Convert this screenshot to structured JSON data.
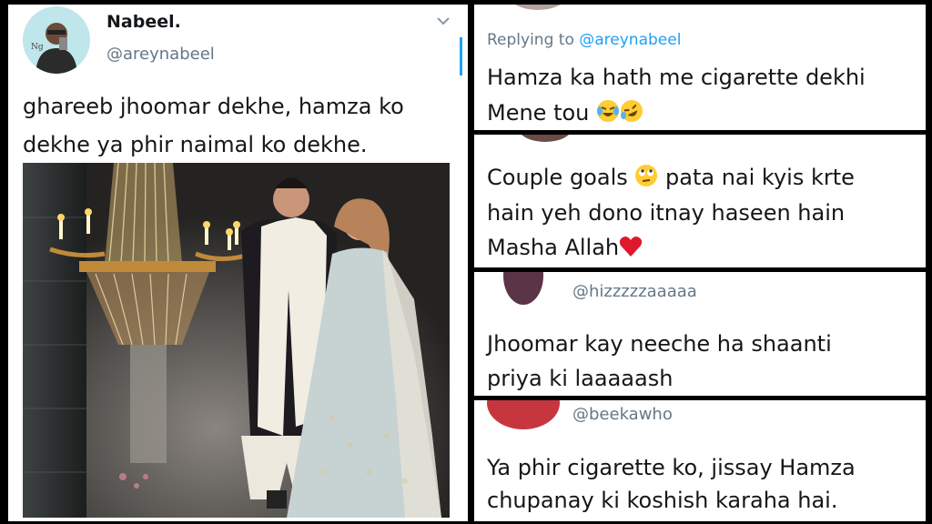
{
  "tweet": {
    "name": "Nabeel.",
    "handle": "@areynabeel",
    "text_line1": "ghareeb jhoomar dekhe, hamza ko",
    "text_line2": "dekhe ya phir naimal ko dekhe.",
    "menu_icon": "chevron-down-icon"
  },
  "replies": [
    {
      "replying_to_prefix": "Replying to ",
      "replying_to_handle": "@areynabeel",
      "line1": "Hamza ka hath me cigarette dekhi",
      "line2": "Mene tou"
    },
    {
      "line1": "Couple goals",
      "line1_rest": "pata nai kyis krte",
      "line2": "hain yeh dono itnay haseen hain",
      "line3": "Masha Allah"
    },
    {
      "handle": "@hizzzzzaaaaa",
      "line1": "Jhoomar kay neeche ha shaanti",
      "line2": "priya ki laaaaash"
    },
    {
      "handle": "@beekawho",
      "line1": "Ya phir cigarette ko, jissay Hamza",
      "line2": "chupanay ki koshish karaha hai."
    }
  ],
  "colors": {
    "accent": "#1da1f2",
    "text": "#14171a",
    "muted": "#657786"
  }
}
